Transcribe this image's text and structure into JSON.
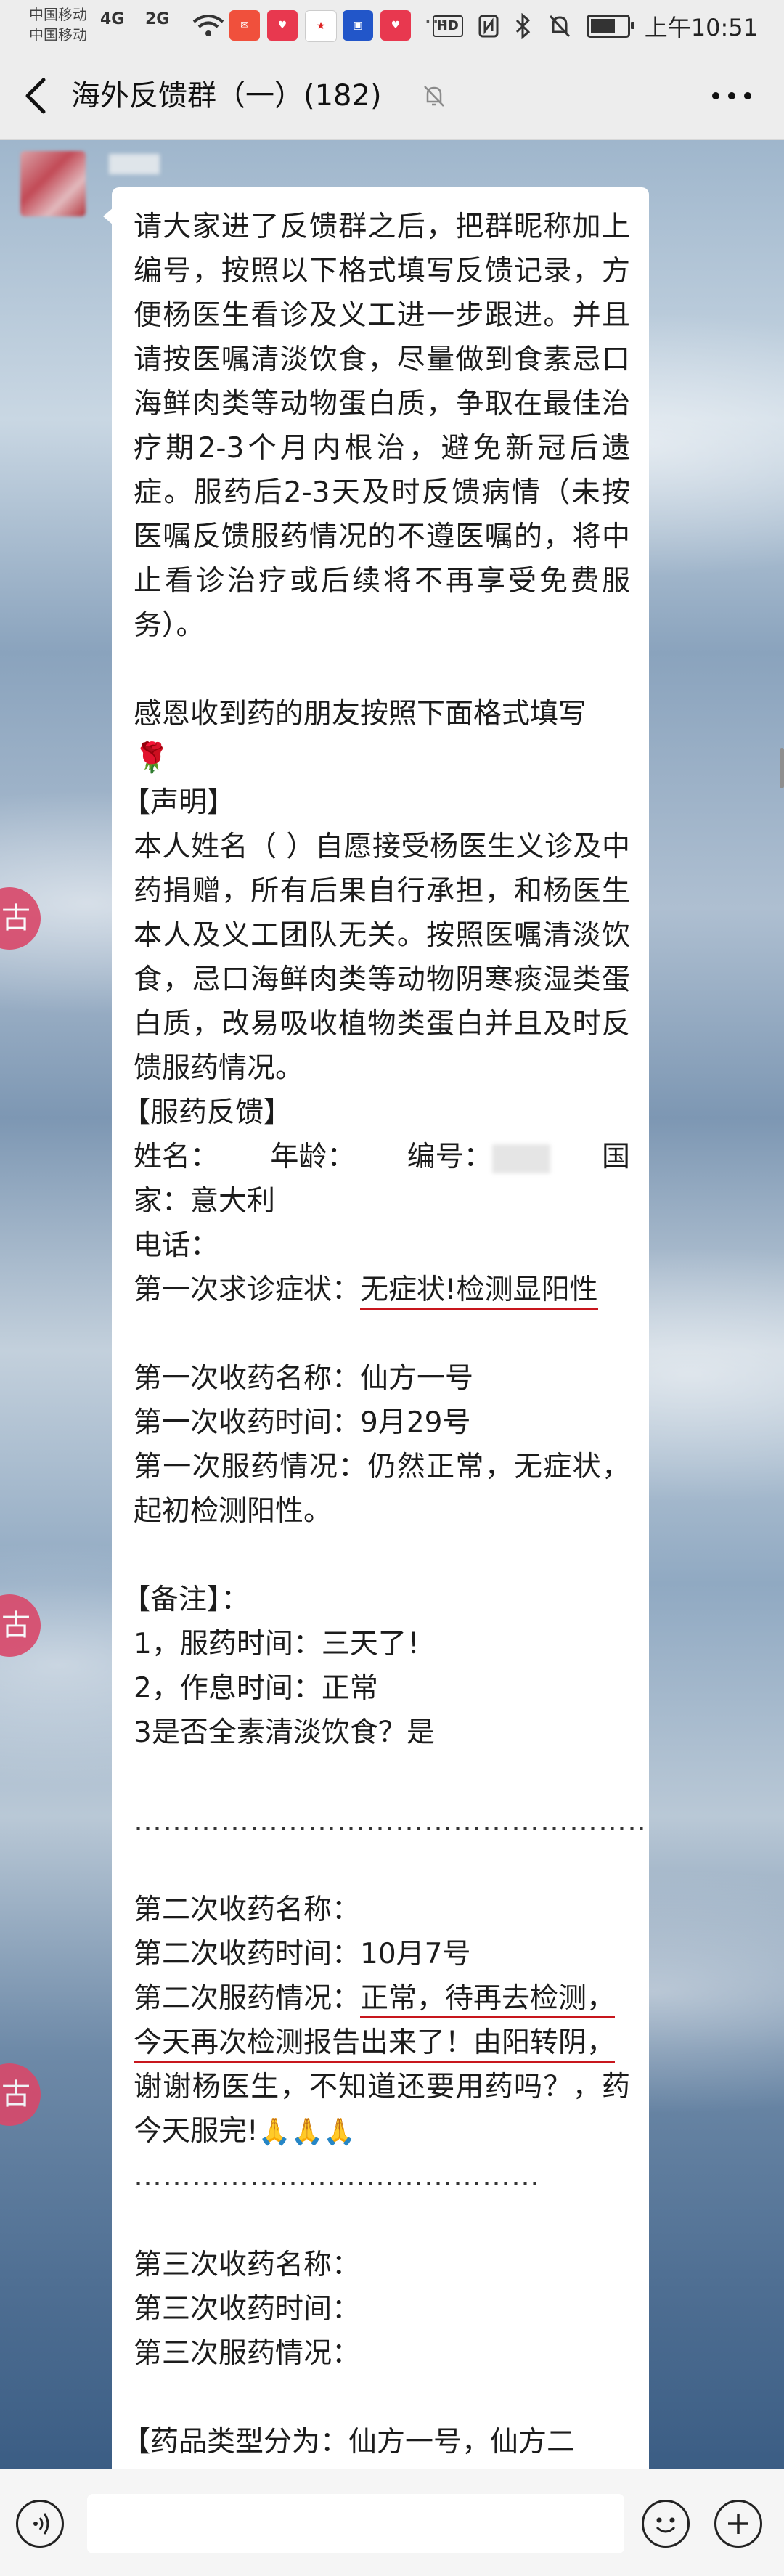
{
  "status_bar": {
    "carrier_1": "中国移动",
    "carrier_2": "中国移动",
    "signal_1": "4G",
    "signal_2": "2G",
    "hd_badge": "HD",
    "time": "上午10:51",
    "battery_level": 0.8
  },
  "nav": {
    "title": "海外反馈群（一）(182)",
    "icons": [
      "back-arrow-icon",
      "mute-bell-icon",
      "more-dots-icon"
    ]
  },
  "side_marks": [
    "古",
    "古",
    "古"
  ],
  "message": {
    "intro": "请大家进了反馈群之后，把群昵称加上编号，按照以下格式填写反馈记录，方便杨医生看诊及义工进一步跟进。并且请按医嘱清淡饮食，尽量做到食素忌口海鲜肉类等动物蛋白质，争取在最佳治疗期2-3个月内根治，避免新冠后遗症。服药后2-3天及时反馈病情（未按医嘱反馈服药情况的不遵医嘱的，将中止看诊治疗或后续将不再享受免费服务）。",
    "thanks": "感恩收到药的朋友按照下面格式填写",
    "declaration_heading": "【声明】",
    "declaration": "本人姓名（ ）自愿接受杨医生义诊及中药捐赠，所有后果自行承担，和杨医生本人及义工团队无关。按照医嘱清淡饮食，忌口海鲜肉类等动物阴寒痰湿类蛋白质，改易吸收植物类蛋白并且及时反馈服药情况。",
    "feedback_heading": "【服药反馈】",
    "name_label": "姓名：",
    "age_label": "年龄：",
    "number_label": "编号：",
    "country_label_start": "国",
    "country_line": "家：意大利",
    "phone_label": "电话：",
    "first_symptom_label": "第一次求诊症状：",
    "first_symptom_value": "无症状!检测显阳性",
    "first_med_name": "第一次收药名称：仙方一号",
    "first_med_time": "第一次收药时间：9月29号",
    "first_status": "第一次服药情况：仍然正常，无症状，起初检测阳性。",
    "remarks_heading": "【备注】：",
    "remark_1": "1，服药时间：三天了！",
    "remark_2": "2，作息时间：正常",
    "remark_3": "3是否全素清淡饮食？是",
    "separator": "………………………………………………",
    "second_med_name": "第二次收药名称：",
    "second_med_time": "第二次收药时间：10月7号",
    "second_status_label": "第二次服药情况：",
    "second_status_ul_1": "正常，待再去检测，",
    "second_status_ul_2": "今天再次检测报告出来了！由阳转阴，",
    "second_status_rest": "谢谢杨医生，不知道还要用药吗？，药今天服完!",
    "pray_emoji": "🙏🙏🙏",
    "separator_2": "……………………………………",
    "third_med_name": "第三次收药名称：",
    "third_med_time": "第三次收药时间：",
    "third_status": "第三次服药情况：",
    "types_line": "【药品类型分为：仙方一号，仙方二号，西种】"
  },
  "input_bar": {
    "placeholder": "",
    "icons": [
      "voice-icon",
      "emoji-icon",
      "plus-icon"
    ]
  }
}
